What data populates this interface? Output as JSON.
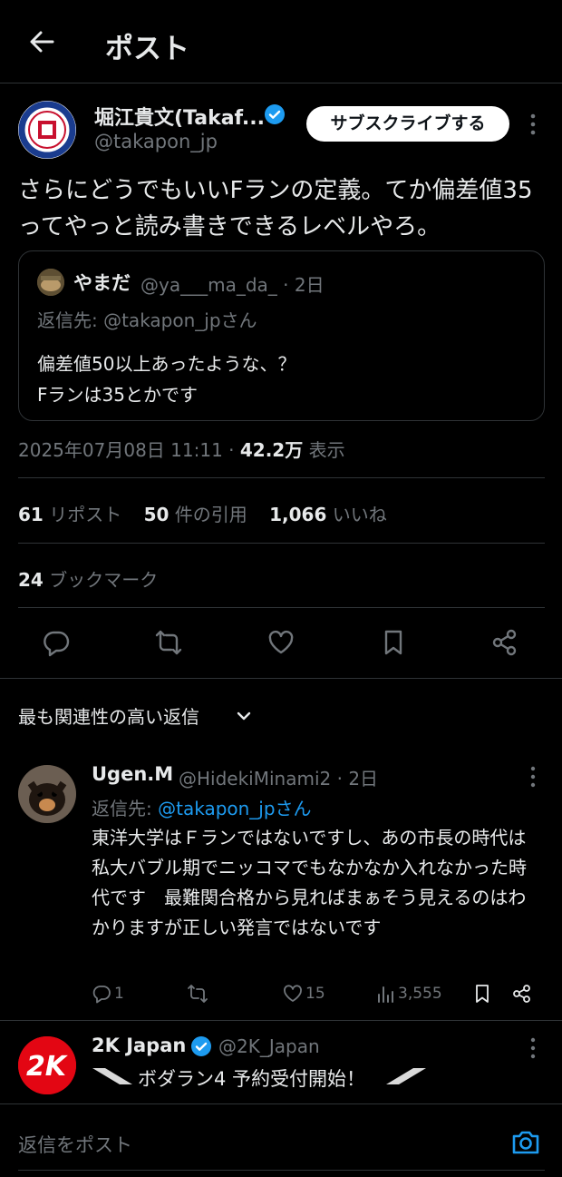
{
  "header": {
    "title": "ポスト"
  },
  "post": {
    "author_name": "堀江貴文(Takaf...",
    "author_handle": "@takapon_jp",
    "subscribe_label": "サブスクライブする",
    "text": "さらにどうでもいいFランの定義。てか偏差値35ってやっと読み書きできるレベルやろ。",
    "quote": {
      "name": "やまだ",
      "handle_time": "@ya___ma_da_ · 2日",
      "reply_to": "返信先: @takapon_jpさん",
      "line1": "偏差値50以上あったような、？",
      "line2": "Fランは35とかです"
    },
    "timestamp": "2025年07月08日 11:11 · ",
    "views_count": "42.2万",
    "views_label": " 表示",
    "stats": {
      "reposts_count": "61",
      "reposts_label": "リポスト",
      "quotes_count": "50",
      "quotes_label": "件の引用",
      "likes_count": "1,066",
      "likes_label": "いいね",
      "bookmarks_count": "24",
      "bookmarks_label": "ブックマーク"
    }
  },
  "sort": {
    "label": "最も関連性の高い返信"
  },
  "reply": {
    "name": "Ugen.M",
    "handle_time": "@HidekiMinami2 · 2日",
    "reply_prefix": "返信先: ",
    "reply_to": "@takapon_jpさん",
    "text": "東洋大学はＦランではないですし、あの市長の時代は私大バブル期でニッコマでもなかなか入れなかった時代です　最難関合格から見ればまぁそう見えるのはわかりますが正しい発言ではないです",
    "replies": "1",
    "likes": "15",
    "views": "3,555"
  },
  "promo": {
    "name": "2K Japan",
    "handle": "@2K_Japan",
    "text": "ボダラン4 予約受付開始！",
    "logo_text": "2K"
  },
  "composer": {
    "placeholder": "返信をポスト"
  },
  "colors": {
    "accent": "#1d9bf0",
    "muted": "#71767b",
    "background": "#000000"
  }
}
